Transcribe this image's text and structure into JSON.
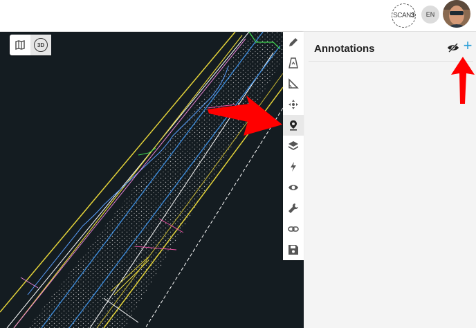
{
  "header": {
    "logo_text": "SCAN",
    "logo_num": "3",
    "language": "EN"
  },
  "view_toggle": {
    "map_icon": "map-icon",
    "mode_3d": "3D"
  },
  "toolbar": {
    "tools": [
      "pencil-icon",
      "measure-volume-icon",
      "angle-icon",
      "move-icon",
      "pin-icon",
      "layers-icon",
      "lightning-icon",
      "eye-icon",
      "wrench-icon",
      "link-icon",
      "save-icon"
    ],
    "active": "pin-icon"
  },
  "panel": {
    "title": "Annotations",
    "add_label": "+"
  },
  "colors": {
    "accent": "#2a9fd8",
    "arrow": "#ff0000",
    "map_bg": "#141c21"
  }
}
